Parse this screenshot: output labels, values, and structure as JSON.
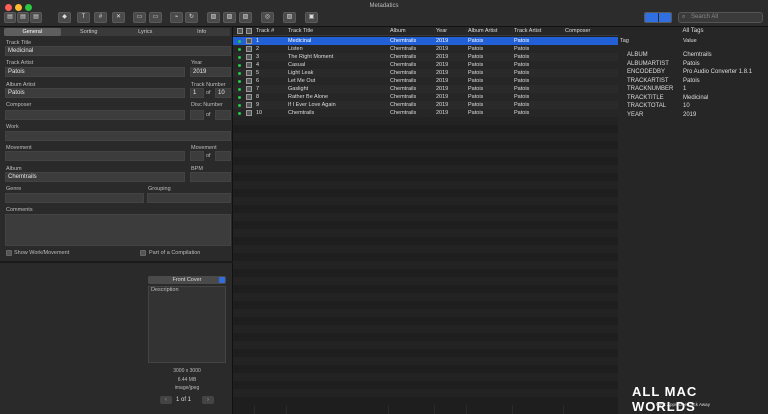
{
  "window": {
    "title": "Metadatics"
  },
  "traffic_colors": [
    "#ff5f57",
    "#febc2e",
    "#28c840"
  ],
  "toolbar": {
    "buttons": [
      "doc-icon",
      "doc-icon",
      "doc-icon",
      "doc-icon",
      "tag-icon",
      "text-icon",
      "number-icon",
      "tools-icon",
      "image-icon",
      "image-icon",
      "link-icon",
      "refresh-icon",
      "wave-icon",
      "image-icon",
      "image-icon",
      "image-icon",
      "globe-icon",
      "image-icon",
      "save-icon"
    ],
    "search_placeholder": "Search All"
  },
  "left_panel": {
    "tabs": [
      "General",
      "Sorting",
      "Lyrics",
      "Info"
    ],
    "active_tab": "General",
    "fields": {
      "track_title_label": "Track Title",
      "track_title": "Medicinal",
      "track_artist_label": "Track Artist",
      "track_artist": "Patois",
      "year_label": "Year",
      "year": "2019",
      "album_artist_label": "Album Artist",
      "album_artist": "Patois",
      "track_number_label": "Track Number",
      "track_number": "1",
      "track_total": "10",
      "of_label": "of",
      "composer_label": "Composer",
      "disc_number_label": "Disc Number",
      "disc_of_label": "of",
      "work_label": "Work",
      "movement_label": "Movement",
      "movement_number_label": "Movement",
      "movement_of_label": "of",
      "album_label": "Album",
      "album": "Chemtrails",
      "bpm_label": "BPM",
      "genre_label": "Genre",
      "grouping_label": "Grouping",
      "comments_label": "Comments",
      "show_work_label": "Show Work/Movement",
      "compilation_label": "Part of a Compilation"
    },
    "artwork": {
      "cover_select": "Front Cover",
      "description_label": "Description",
      "dimensions": "3000 x 3000",
      "size": "6.44 MB",
      "format": "image/jpeg",
      "page": "1 of 1"
    }
  },
  "table": {
    "headers": [
      "Track #",
      "Track Title",
      "Album",
      "Year",
      "Album Artist",
      "Track Artist",
      "Composer"
    ],
    "selected_row": 0,
    "rows": [
      {
        "num": "1",
        "title": "Medicinal",
        "album": "Chemtrails",
        "year": "2019",
        "album_artist": "Patois",
        "track_artist": "Patois"
      },
      {
        "num": "2",
        "title": "Listen",
        "album": "Chemtrails",
        "year": "2019",
        "album_artist": "Patois",
        "track_artist": "Patois"
      },
      {
        "num": "3",
        "title": "The Right Moment",
        "album": "Chemtrails",
        "year": "2019",
        "album_artist": "Patois",
        "track_artist": "Patois"
      },
      {
        "num": "4",
        "title": "Casual",
        "album": "Chemtrails",
        "year": "2019",
        "album_artist": "Patois",
        "track_artist": "Patois"
      },
      {
        "num": "5",
        "title": "Light Leak",
        "album": "Chemtrails",
        "year": "2019",
        "album_artist": "Patois",
        "track_artist": "Patois"
      },
      {
        "num": "6",
        "title": "Let Me Out",
        "album": "Chemtrails",
        "year": "2019",
        "album_artist": "Patois",
        "track_artist": "Patois"
      },
      {
        "num": "7",
        "title": "Gaslight",
        "album": "Chemtrails",
        "year": "2019",
        "album_artist": "Patois",
        "track_artist": "Patois"
      },
      {
        "num": "8",
        "title": "Rather Be Alone",
        "album": "Chemtrails",
        "year": "2019",
        "album_artist": "Patois",
        "track_artist": "Patois"
      },
      {
        "num": "9",
        "title": "If I Ever Love Again",
        "album": "Chemtrails",
        "year": "2019",
        "album_artist": "Patois",
        "track_artist": "Patois"
      },
      {
        "num": "10",
        "title": "Chemtrails",
        "album": "Chemtrails",
        "year": "2019",
        "album_artist": "Patois",
        "track_artist": "Patois"
      }
    ]
  },
  "tags_panel": {
    "title": "All Tags",
    "col_tag": "Tag",
    "col_value": "Value",
    "rows": [
      {
        "k": "ALBUM",
        "v": "Chemtrails"
      },
      {
        "k": "ALBUMARTIST",
        "v": "Patois"
      },
      {
        "k": "ENCODEDBY",
        "v": "Pro Audio Converter 1.8.1"
      },
      {
        "k": "TRACKARTIST",
        "v": "Patois"
      },
      {
        "k": "TRACKNUMBER",
        "v": "1"
      },
      {
        "k": "TRACKTITLE",
        "v": "Medicinal"
      },
      {
        "k": "TRACKTOTAL",
        "v": "10"
      },
      {
        "k": "YEAR",
        "v": "2019"
      }
    ]
  },
  "watermark": {
    "brand": "ALL MAC WORLDS",
    "tagline": "MAC Apps One Click Away"
  },
  "colors": {
    "selection": "#2160d6",
    "accent": "#2f6fe0"
  }
}
